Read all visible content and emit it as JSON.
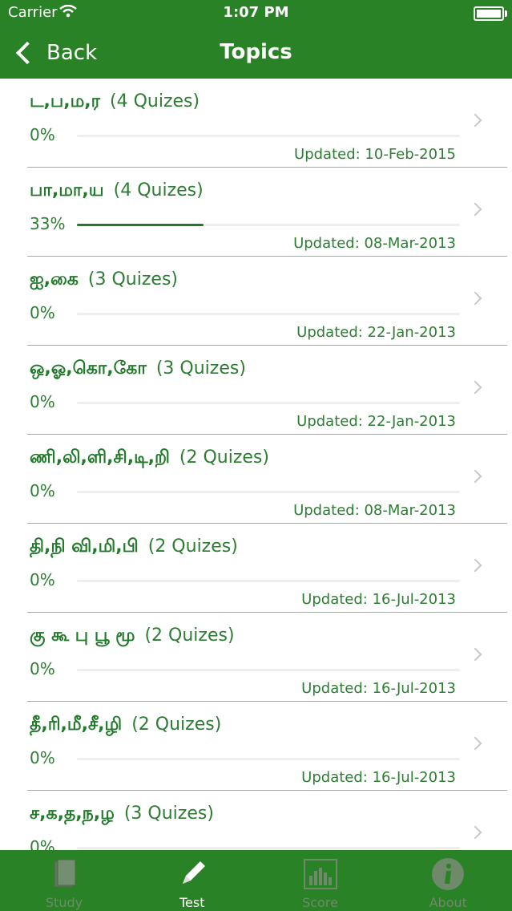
{
  "status_bar": {
    "carrier": "Carrier",
    "time": "1:07 PM"
  },
  "nav": {
    "back_label": "Back",
    "title": "Topics"
  },
  "topics": [
    {
      "name": "ட,ப,ம,ர",
      "count": "(4 Quizes)",
      "percent": "0%",
      "progress": 0,
      "updated": "Updated: 10-Feb-2015"
    },
    {
      "name": "பா,மா,ய",
      "count": "(4 Quizes)",
      "percent": "33%",
      "progress": 0.33,
      "updated": "Updated: 08-Mar-2013"
    },
    {
      "name": "ஐ,கை",
      "count": "(3 Quizes)",
      "percent": "0%",
      "progress": 0,
      "updated": "Updated: 22-Jan-2013"
    },
    {
      "name": "ஒ,ஓ,கொ,கோ",
      "count": "(3 Quizes)",
      "percent": "0%",
      "progress": 0,
      "updated": "Updated: 22-Jan-2013"
    },
    {
      "name": "ணி,லி,ளி,சி,டி,றி",
      "count": "(2 Quizes)",
      "percent": "0%",
      "progress": 0,
      "updated": "Updated: 08-Mar-2013"
    },
    {
      "name": "தி,நி வி,மி,பி",
      "count": "(2 Quizes)",
      "percent": "0%",
      "progress": 0,
      "updated": "Updated: 16-Jul-2013"
    },
    {
      "name": "கு கூ பு பூ மூ",
      "count": "(2 Quizes)",
      "percent": "0%",
      "progress": 0,
      "updated": "Updated: 16-Jul-2013"
    },
    {
      "name": "தீ,ரி,மீ,சீ,ழி",
      "count": "(2 Quizes)",
      "percent": "0%",
      "progress": 0,
      "updated": "Updated: 16-Jul-2013"
    },
    {
      "name": "ச,க,த,ந,ழ",
      "count": "(3 Quizes)",
      "percent": "0%",
      "progress": 0,
      "updated": ""
    }
  ],
  "tabs": [
    {
      "label": "Study",
      "icon": "book-icon",
      "active": false
    },
    {
      "label": "Test",
      "icon": "pencil-icon",
      "active": true
    },
    {
      "label": "Score",
      "icon": "bar-chart-icon",
      "active": false
    },
    {
      "label": "About",
      "icon": "info-icon",
      "active": false
    }
  ],
  "colors": {
    "accent": "#2a8227",
    "text": "#1f7a2b",
    "separator": "#a8a8a8"
  }
}
